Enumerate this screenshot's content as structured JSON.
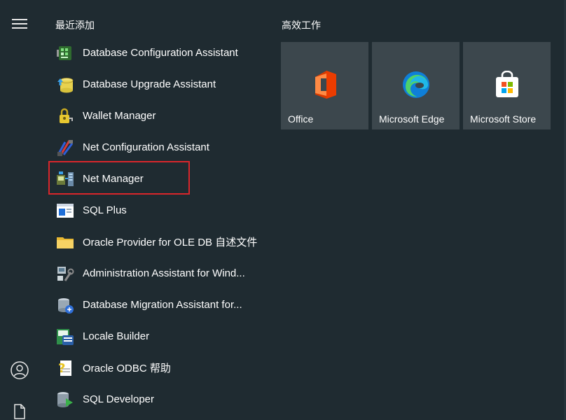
{
  "sections": {
    "recent": "最近添加",
    "productivity": "高效工作"
  },
  "apps": [
    {
      "label": "Database Configuration Assistant",
      "icon": "database-config-icon"
    },
    {
      "label": "Database Upgrade Assistant",
      "icon": "database-upgrade-icon"
    },
    {
      "label": "Wallet Manager",
      "icon": "wallet-key-icon"
    },
    {
      "label": "Net Configuration Assistant",
      "icon": "net-config-icon"
    },
    {
      "label": "Net Manager",
      "icon": "net-manager-icon"
    },
    {
      "label": "SQL Plus",
      "icon": "sqlplus-window-icon"
    },
    {
      "label": "Oracle Provider for OLE DB 自述文件",
      "icon": "folder-icon"
    },
    {
      "label": "Administration Assistant for Wind...",
      "icon": "admin-tools-icon"
    },
    {
      "label": "Database Migration Assistant for...",
      "icon": "database-migration-icon"
    },
    {
      "label": "Locale Builder",
      "icon": "locale-builder-icon"
    },
    {
      "label": "Oracle ODBC 帮助",
      "icon": "help-question-icon"
    },
    {
      "label": "SQL Developer",
      "icon": "sql-developer-icon"
    }
  ],
  "tiles": [
    {
      "label": "Office",
      "icon": "office-icon"
    },
    {
      "label": "Microsoft Edge",
      "icon": "edge-icon"
    },
    {
      "label": "Microsoft Store",
      "icon": "store-icon"
    }
  ],
  "colors": {
    "background": "#1f2b31",
    "tile": "#3c474d",
    "highlight_border": "#d9262b"
  }
}
